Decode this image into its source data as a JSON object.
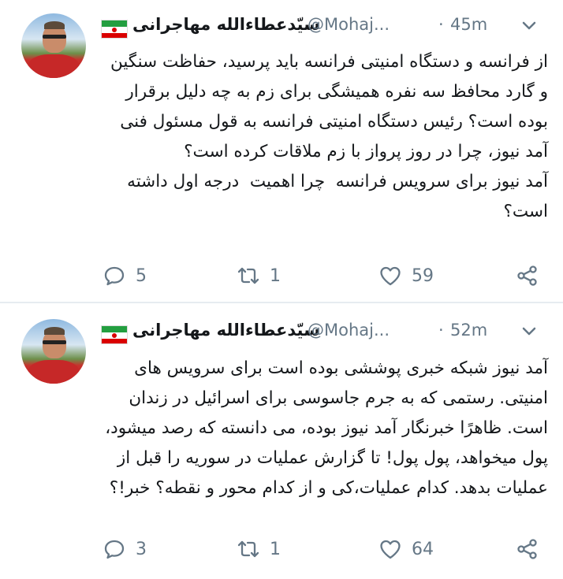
{
  "tweets": [
    {
      "author_name": "سیّدعطاءالله مهاجرانی",
      "handle": "@Mohaj...",
      "separator": "·",
      "time": "45m",
      "text": "از فرانسه و دستگاه امنیتی فرانسه باید پرسید، حفاظت سنگین و گارد محافظ سه نفره همیشگی برای زم به چه دلیل برقرار بوده است؟ رئیس دستگاه امنیتی فرانسه به قول مسئول فنی آمد نیوز، چرا در روز پرواز با زم ملاقات کرده است؟\nآمد نیوز برای سرویس فرانسه  چرا اهمیت  درجه اول داشته است؟",
      "replies": "5",
      "retweets": "1",
      "likes": "59"
    },
    {
      "author_name": "سیّدعطاءالله مهاجرانی",
      "handle": "@Mohaj...",
      "separator": "·",
      "time": "52m",
      "text": "آمد نیوز شبکه خبری پوششی بوده است برای سرویس های امنیتی. رستمی که به جرم جاسوسی برای اسرائیل در زندان است. ظاهرًا خبرنگار آمد نیوز بوده، می دانسته که رصد میشود، پول میخواهد، پول پول! تا گزارش عملیات در سوریه را قبل از عملیات بدهد. کدام عملیات،کی و از کدام محور و نقطه؟ خبر!؟",
      "replies": "3",
      "retweets": "1",
      "likes": "64"
    }
  ],
  "icons": {
    "flag": "iran-flag-icon",
    "menu": "chevron-down-icon",
    "reply": "reply-icon",
    "retweet": "retweet-icon",
    "like": "heart-icon",
    "share": "share-icon"
  },
  "colors": {
    "text": "#14171a",
    "muted": "#657786",
    "divider": "#e6ecf0"
  }
}
